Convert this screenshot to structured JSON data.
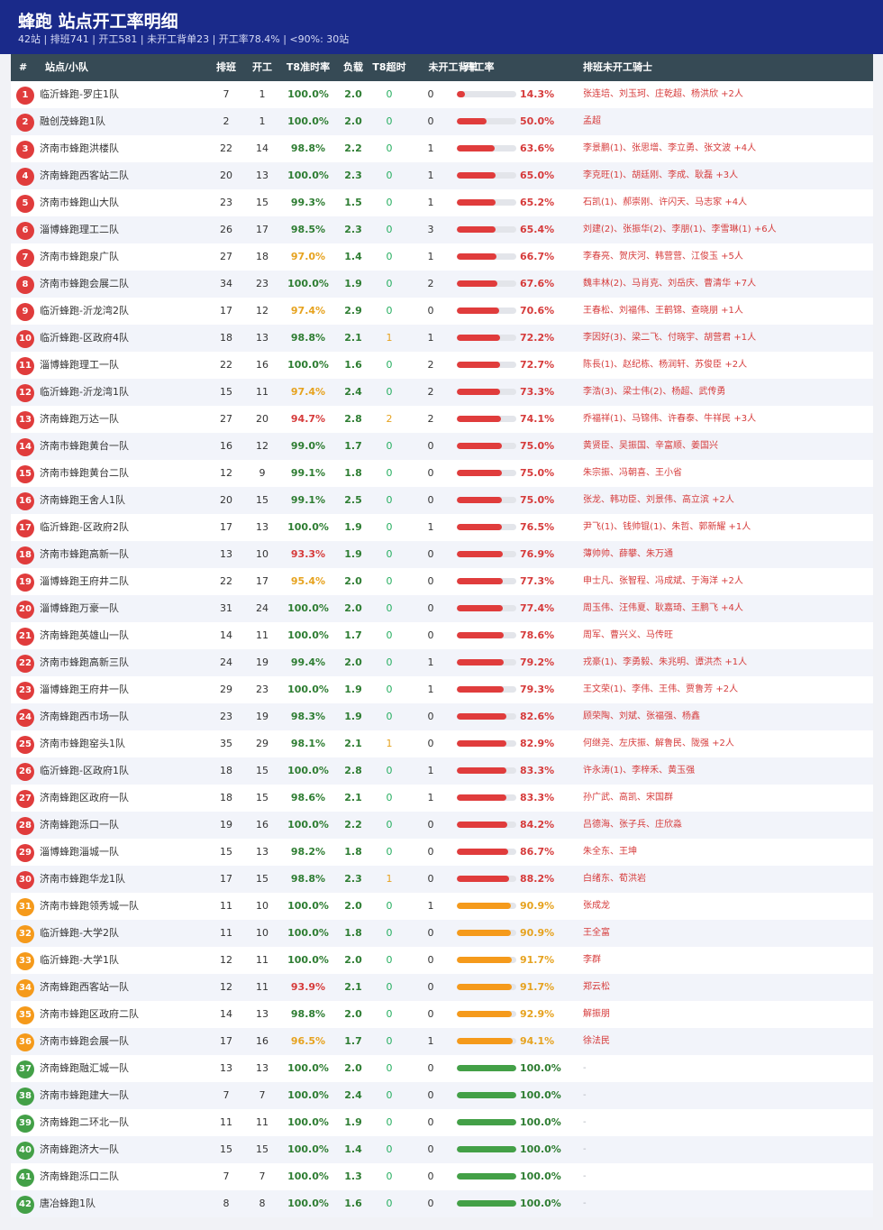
{
  "header": {
    "title": "蜂跑 站点开工率明细",
    "subtitle": "42站 | 排班741 | 开工581 | 未开工背单23 | 开工率78.4% | <90%: 30站"
  },
  "columns": {
    "rank": "#",
    "name": "站点/小队",
    "scheduled": "排班",
    "opened": "开工",
    "t8_rate": "T8准时率",
    "load": "负载",
    "t8_overtime": "T8超时",
    "backlog": "未开工背单",
    "open_rate": "开工率",
    "riders": "排班未开工骑士"
  },
  "colors": {
    "red": "#e03c3c",
    "orange": "#f59a1b",
    "green": "#43a047",
    "rate_green": "#2e7d32",
    "rate_orange": "#e6a21e",
    "rate_red": "#d63b3b"
  },
  "rows": [
    {
      "rank": "1",
      "name": "临沂蜂跑-罗庄1队",
      "scheduled": "7",
      "opened": "1",
      "t8_rate": "100.0%",
      "load": "2.0",
      "t8_overtime": "0",
      "backlog": "0",
      "open_rate": "14.3%",
      "riders": "张连培、刘玉珂、庄乾超、杨洪欣 +2人"
    },
    {
      "rank": "2",
      "name": "融创茂蜂跑1队",
      "scheduled": "2",
      "opened": "1",
      "t8_rate": "100.0%",
      "load": "2.0",
      "t8_overtime": "0",
      "backlog": "0",
      "open_rate": "50.0%",
      "riders": "孟超"
    },
    {
      "rank": "3",
      "name": "济南市蜂跑洪楼队",
      "scheduled": "22",
      "opened": "14",
      "t8_rate": "98.8%",
      "load": "2.2",
      "t8_overtime": "0",
      "backlog": "1",
      "open_rate": "63.6%",
      "riders": "李景鹏(1)、张思增、李立勇、张文波 +4人"
    },
    {
      "rank": "4",
      "name": "济南蜂跑西客站二队",
      "scheduled": "20",
      "opened": "13",
      "t8_rate": "100.0%",
      "load": "2.3",
      "t8_overtime": "0",
      "backlog": "1",
      "open_rate": "65.0%",
      "riders": "李克旺(1)、胡廷刚、李成、耿磊 +3人"
    },
    {
      "rank": "5",
      "name": "济南市蜂跑山大队",
      "scheduled": "23",
      "opened": "15",
      "t8_rate": "99.3%",
      "load": "1.5",
      "t8_overtime": "0",
      "backlog": "1",
      "open_rate": "65.2%",
      "riders": "石凯(1)、郝崇刚、许闪天、马志家 +4人"
    },
    {
      "rank": "6",
      "name": "淄博蜂跑理工二队",
      "scheduled": "26",
      "opened": "17",
      "t8_rate": "98.5%",
      "load": "2.3",
      "t8_overtime": "0",
      "backlog": "3",
      "open_rate": "65.4%",
      "riders": "刘建(2)、张振华(2)、李朋(1)、李雪琳(1) +6人"
    },
    {
      "rank": "7",
      "name": "济南市蜂跑泉广队",
      "scheduled": "27",
      "opened": "18",
      "t8_rate": "97.0%",
      "load": "1.4",
      "t8_overtime": "0",
      "backlog": "1",
      "open_rate": "66.7%",
      "riders": "李春亮、贺庆河、韩营营、江俊玉 +5人"
    },
    {
      "rank": "8",
      "name": "济南市蜂跑会展二队",
      "scheduled": "34",
      "opened": "23",
      "t8_rate": "100.0%",
      "load": "1.9",
      "t8_overtime": "0",
      "backlog": "2",
      "open_rate": "67.6%",
      "riders": "魏丰林(2)、马肖克、刘岳庆、曹清华 +7人"
    },
    {
      "rank": "9",
      "name": "临沂蜂跑-沂龙湾2队",
      "scheduled": "17",
      "opened": "12",
      "t8_rate": "97.4%",
      "load": "2.9",
      "t8_overtime": "0",
      "backlog": "0",
      "open_rate": "70.6%",
      "riders": "王春松、刘福伟、王鹤锦、查晓朋 +1人"
    },
    {
      "rank": "10",
      "name": "临沂蜂跑-区政府4队",
      "scheduled": "18",
      "opened": "13",
      "t8_rate": "98.8%",
      "load": "2.1",
      "t8_overtime": "1",
      "backlog": "1",
      "open_rate": "72.2%",
      "riders": "李因好(3)、梁二飞、付晓宇、胡营君 +1人"
    },
    {
      "rank": "11",
      "name": "淄博蜂跑理工一队",
      "scheduled": "22",
      "opened": "16",
      "t8_rate": "100.0%",
      "load": "1.6",
      "t8_overtime": "0",
      "backlog": "2",
      "open_rate": "72.7%",
      "riders": "陈長(1)、赵纪栋、杨润轩、苏俊臣 +2人"
    },
    {
      "rank": "12",
      "name": "临沂蜂跑-沂龙湾1队",
      "scheduled": "15",
      "opened": "11",
      "t8_rate": "97.4%",
      "load": "2.4",
      "t8_overtime": "0",
      "backlog": "2",
      "open_rate": "73.3%",
      "riders": "李浩(3)、梁士伟(2)、杨超、武传勇"
    },
    {
      "rank": "13",
      "name": "济南蜂跑万达一队",
      "scheduled": "27",
      "opened": "20",
      "t8_rate": "94.7%",
      "load": "2.8",
      "t8_overtime": "2",
      "backlog": "2",
      "open_rate": "74.1%",
      "riders": "乔福祥(1)、马锦伟、许春泰、牛祥民 +3人"
    },
    {
      "rank": "14",
      "name": "济南市蜂跑黄台一队",
      "scheduled": "16",
      "opened": "12",
      "t8_rate": "99.0%",
      "load": "1.7",
      "t8_overtime": "0",
      "backlog": "0",
      "open_rate": "75.0%",
      "riders": "黄贤臣、吴振国、辛富顺、姜国兴"
    },
    {
      "rank": "15",
      "name": "济南市蜂跑黄台二队",
      "scheduled": "12",
      "opened": "9",
      "t8_rate": "99.1%",
      "load": "1.8",
      "t8_overtime": "0",
      "backlog": "0",
      "open_rate": "75.0%",
      "riders": "朱宗振、冯朝喜、王小省"
    },
    {
      "rank": "16",
      "name": "济南蜂跑王舍人1队",
      "scheduled": "20",
      "opened": "15",
      "t8_rate": "99.1%",
      "load": "2.5",
      "t8_overtime": "0",
      "backlog": "0",
      "open_rate": "75.0%",
      "riders": "张龙、韩功臣、刘景伟、高立滨 +2人"
    },
    {
      "rank": "17",
      "name": "临沂蜂跑-区政府2队",
      "scheduled": "17",
      "opened": "13",
      "t8_rate": "100.0%",
      "load": "1.9",
      "t8_overtime": "0",
      "backlog": "1",
      "open_rate": "76.5%",
      "riders": "尹飞(1)、钱帅锟(1)、朱哲、郭新耀 +1人"
    },
    {
      "rank": "18",
      "name": "济南市蜂跑高新一队",
      "scheduled": "13",
      "opened": "10",
      "t8_rate": "93.3%",
      "load": "1.9",
      "t8_overtime": "0",
      "backlog": "0",
      "open_rate": "76.9%",
      "riders": "薄帅帅、薛攀、朱万通"
    },
    {
      "rank": "19",
      "name": "淄博蜂跑王府井二队",
      "scheduled": "22",
      "opened": "17",
      "t8_rate": "95.4%",
      "load": "2.0",
      "t8_overtime": "0",
      "backlog": "0",
      "open_rate": "77.3%",
      "riders": "申士凡、张智程、冯成斌、于海洋 +2人"
    },
    {
      "rank": "20",
      "name": "淄博蜂跑万豪一队",
      "scheduled": "31",
      "opened": "24",
      "t8_rate": "100.0%",
      "load": "2.0",
      "t8_overtime": "0",
      "backlog": "0",
      "open_rate": "77.4%",
      "riders": "周玉伟、汪伟夏、耿嘉琦、王鹏飞 +4人"
    },
    {
      "rank": "21",
      "name": "济南蜂跑英雄山一队",
      "scheduled": "14",
      "opened": "11",
      "t8_rate": "100.0%",
      "load": "1.7",
      "t8_overtime": "0",
      "backlog": "0",
      "open_rate": "78.6%",
      "riders": "周军、曹兴义、马传旺"
    },
    {
      "rank": "22",
      "name": "济南市蜂跑高新三队",
      "scheduled": "24",
      "opened": "19",
      "t8_rate": "99.4%",
      "load": "2.0",
      "t8_overtime": "0",
      "backlog": "1",
      "open_rate": "79.2%",
      "riders": "戎豪(1)、李勇毅、朱兆明、谭洪杰 +1人"
    },
    {
      "rank": "23",
      "name": "淄博蜂跑王府井一队",
      "scheduled": "29",
      "opened": "23",
      "t8_rate": "100.0%",
      "load": "1.9",
      "t8_overtime": "0",
      "backlog": "1",
      "open_rate": "79.3%",
      "riders": "王文荣(1)、李伟、王伟、贾鲁芳 +2人"
    },
    {
      "rank": "24",
      "name": "济南蜂跑西市场一队",
      "scheduled": "23",
      "opened": "19",
      "t8_rate": "98.3%",
      "load": "1.9",
      "t8_overtime": "0",
      "backlog": "0",
      "open_rate": "82.6%",
      "riders": "顾荣陶、刘斌、张福强、杨鑫"
    },
    {
      "rank": "25",
      "name": "济南市蜂跑窑头1队",
      "scheduled": "35",
      "opened": "29",
      "t8_rate": "98.1%",
      "load": "2.1",
      "t8_overtime": "1",
      "backlog": "0",
      "open_rate": "82.9%",
      "riders": "何继尧、左庆振、解鲁民、陇强 +2人"
    },
    {
      "rank": "26",
      "name": "临沂蜂跑-区政府1队",
      "scheduled": "18",
      "opened": "15",
      "t8_rate": "100.0%",
      "load": "2.8",
      "t8_overtime": "0",
      "backlog": "1",
      "open_rate": "83.3%",
      "riders": "许永涛(1)、李梓禾、黄玉强"
    },
    {
      "rank": "27",
      "name": "济南蜂跑区政府一队",
      "scheduled": "18",
      "opened": "15",
      "t8_rate": "98.6%",
      "load": "2.1",
      "t8_overtime": "0",
      "backlog": "1",
      "open_rate": "83.3%",
      "riders": "孙广武、高凯、宋国群"
    },
    {
      "rank": "28",
      "name": "济南蜂跑泺口一队",
      "scheduled": "19",
      "opened": "16",
      "t8_rate": "100.0%",
      "load": "2.2",
      "t8_overtime": "0",
      "backlog": "0",
      "open_rate": "84.2%",
      "riders": "吕德海、张子兵、庄欣淼"
    },
    {
      "rank": "29",
      "name": "淄博蜂跑淄城一队",
      "scheduled": "15",
      "opened": "13",
      "t8_rate": "98.2%",
      "load": "1.8",
      "t8_overtime": "0",
      "backlog": "0",
      "open_rate": "86.7%",
      "riders": "朱全东、王坤"
    },
    {
      "rank": "30",
      "name": "济南市蜂跑华龙1队",
      "scheduled": "17",
      "opened": "15",
      "t8_rate": "98.8%",
      "load": "2.3",
      "t8_overtime": "1",
      "backlog": "0",
      "open_rate": "88.2%",
      "riders": "白绪东、荀洪岩"
    },
    {
      "rank": "31",
      "name": "济南市蜂跑领秀城一队",
      "scheduled": "11",
      "opened": "10",
      "t8_rate": "100.0%",
      "load": "2.0",
      "t8_overtime": "0",
      "backlog": "1",
      "open_rate": "90.9%",
      "riders": "张成龙"
    },
    {
      "rank": "32",
      "name": "临沂蜂跑-大学2队",
      "scheduled": "11",
      "opened": "10",
      "t8_rate": "100.0%",
      "load": "1.8",
      "t8_overtime": "0",
      "backlog": "0",
      "open_rate": "90.9%",
      "riders": "王全富"
    },
    {
      "rank": "33",
      "name": "临沂蜂跑-大学1队",
      "scheduled": "12",
      "opened": "11",
      "t8_rate": "100.0%",
      "load": "2.0",
      "t8_overtime": "0",
      "backlog": "0",
      "open_rate": "91.7%",
      "riders": "李群"
    },
    {
      "rank": "34",
      "name": "济南蜂跑西客站一队",
      "scheduled": "12",
      "opened": "11",
      "t8_rate": "93.9%",
      "load": "2.1",
      "t8_overtime": "0",
      "backlog": "0",
      "open_rate": "91.7%",
      "riders": "郑云松"
    },
    {
      "rank": "35",
      "name": "济南市蜂跑区政府二队",
      "scheduled": "14",
      "opened": "13",
      "t8_rate": "98.8%",
      "load": "2.0",
      "t8_overtime": "0",
      "backlog": "0",
      "open_rate": "92.9%",
      "riders": "解振朋"
    },
    {
      "rank": "36",
      "name": "济南市蜂跑会展一队",
      "scheduled": "17",
      "opened": "16",
      "t8_rate": "96.5%",
      "load": "1.7",
      "t8_overtime": "0",
      "backlog": "1",
      "open_rate": "94.1%",
      "riders": "徐法民"
    },
    {
      "rank": "37",
      "name": "济南蜂跑融汇城一队",
      "scheduled": "13",
      "opened": "13",
      "t8_rate": "100.0%",
      "load": "2.0",
      "t8_overtime": "0",
      "backlog": "0",
      "open_rate": "100.0%",
      "riders": "-"
    },
    {
      "rank": "38",
      "name": "济南市蜂跑建大一队",
      "scheduled": "7",
      "opened": "7",
      "t8_rate": "100.0%",
      "load": "2.4",
      "t8_overtime": "0",
      "backlog": "0",
      "open_rate": "100.0%",
      "riders": "-"
    },
    {
      "rank": "39",
      "name": "济南蜂跑二环北一队",
      "scheduled": "11",
      "opened": "11",
      "t8_rate": "100.0%",
      "load": "1.9",
      "t8_overtime": "0",
      "backlog": "0",
      "open_rate": "100.0%",
      "riders": "-"
    },
    {
      "rank": "40",
      "name": "济南蜂跑济大一队",
      "scheduled": "15",
      "opened": "15",
      "t8_rate": "100.0%",
      "load": "1.4",
      "t8_overtime": "0",
      "backlog": "0",
      "open_rate": "100.0%",
      "riders": "-"
    },
    {
      "rank": "41",
      "name": "济南蜂跑泺口二队",
      "scheduled": "7",
      "opened": "7",
      "t8_rate": "100.0%",
      "load": "1.3",
      "t8_overtime": "0",
      "backlog": "0",
      "open_rate": "100.0%",
      "riders": "-"
    },
    {
      "rank": "42",
      "name": "唐冶蜂跑1队",
      "scheduled": "8",
      "opened": "8",
      "t8_rate": "100.0%",
      "load": "1.6",
      "t8_overtime": "0",
      "backlog": "0",
      "open_rate": "100.0%",
      "riders": "-"
    }
  ]
}
